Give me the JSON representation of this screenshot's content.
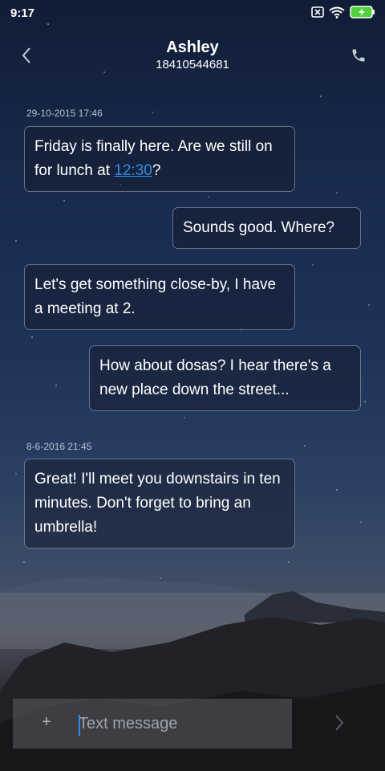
{
  "status_bar": {
    "time": "9:17",
    "icons": [
      "sim-off-icon",
      "wifi-icon",
      "battery-charging-icon"
    ]
  },
  "header": {
    "contact_name": "Ashley",
    "contact_number": "18410544681",
    "back_icon": "chevron-left-icon",
    "call_icon": "phone-icon"
  },
  "thread": {
    "timestamps": [
      "29-10-2015 17:46",
      "8-6-2016 21:45"
    ],
    "messages": [
      {
        "direction": "received",
        "text_before": "Friday is finally here. Are we still on for lunch at ",
        "link": "12:30",
        "text_after": "?"
      },
      {
        "direction": "sent",
        "text": "Sounds good. Where?"
      },
      {
        "direction": "received",
        "text": "Let's get something close-by, I have a meeting at 2."
      },
      {
        "direction": "sent",
        "text": "How about dosas? I hear there's a new place down the street..."
      },
      {
        "direction": "received",
        "text": "Great! I'll meet you downstairs in ten minutes. Don't forget to bring an umbrella!"
      }
    ]
  },
  "composer": {
    "add_label": "+",
    "placeholder": "Text message",
    "send_icon": "chevron-right-icon"
  },
  "colors": {
    "link": "#2f8eea",
    "text": "#ffffff",
    "timestamp": "#b8c0cf"
  }
}
